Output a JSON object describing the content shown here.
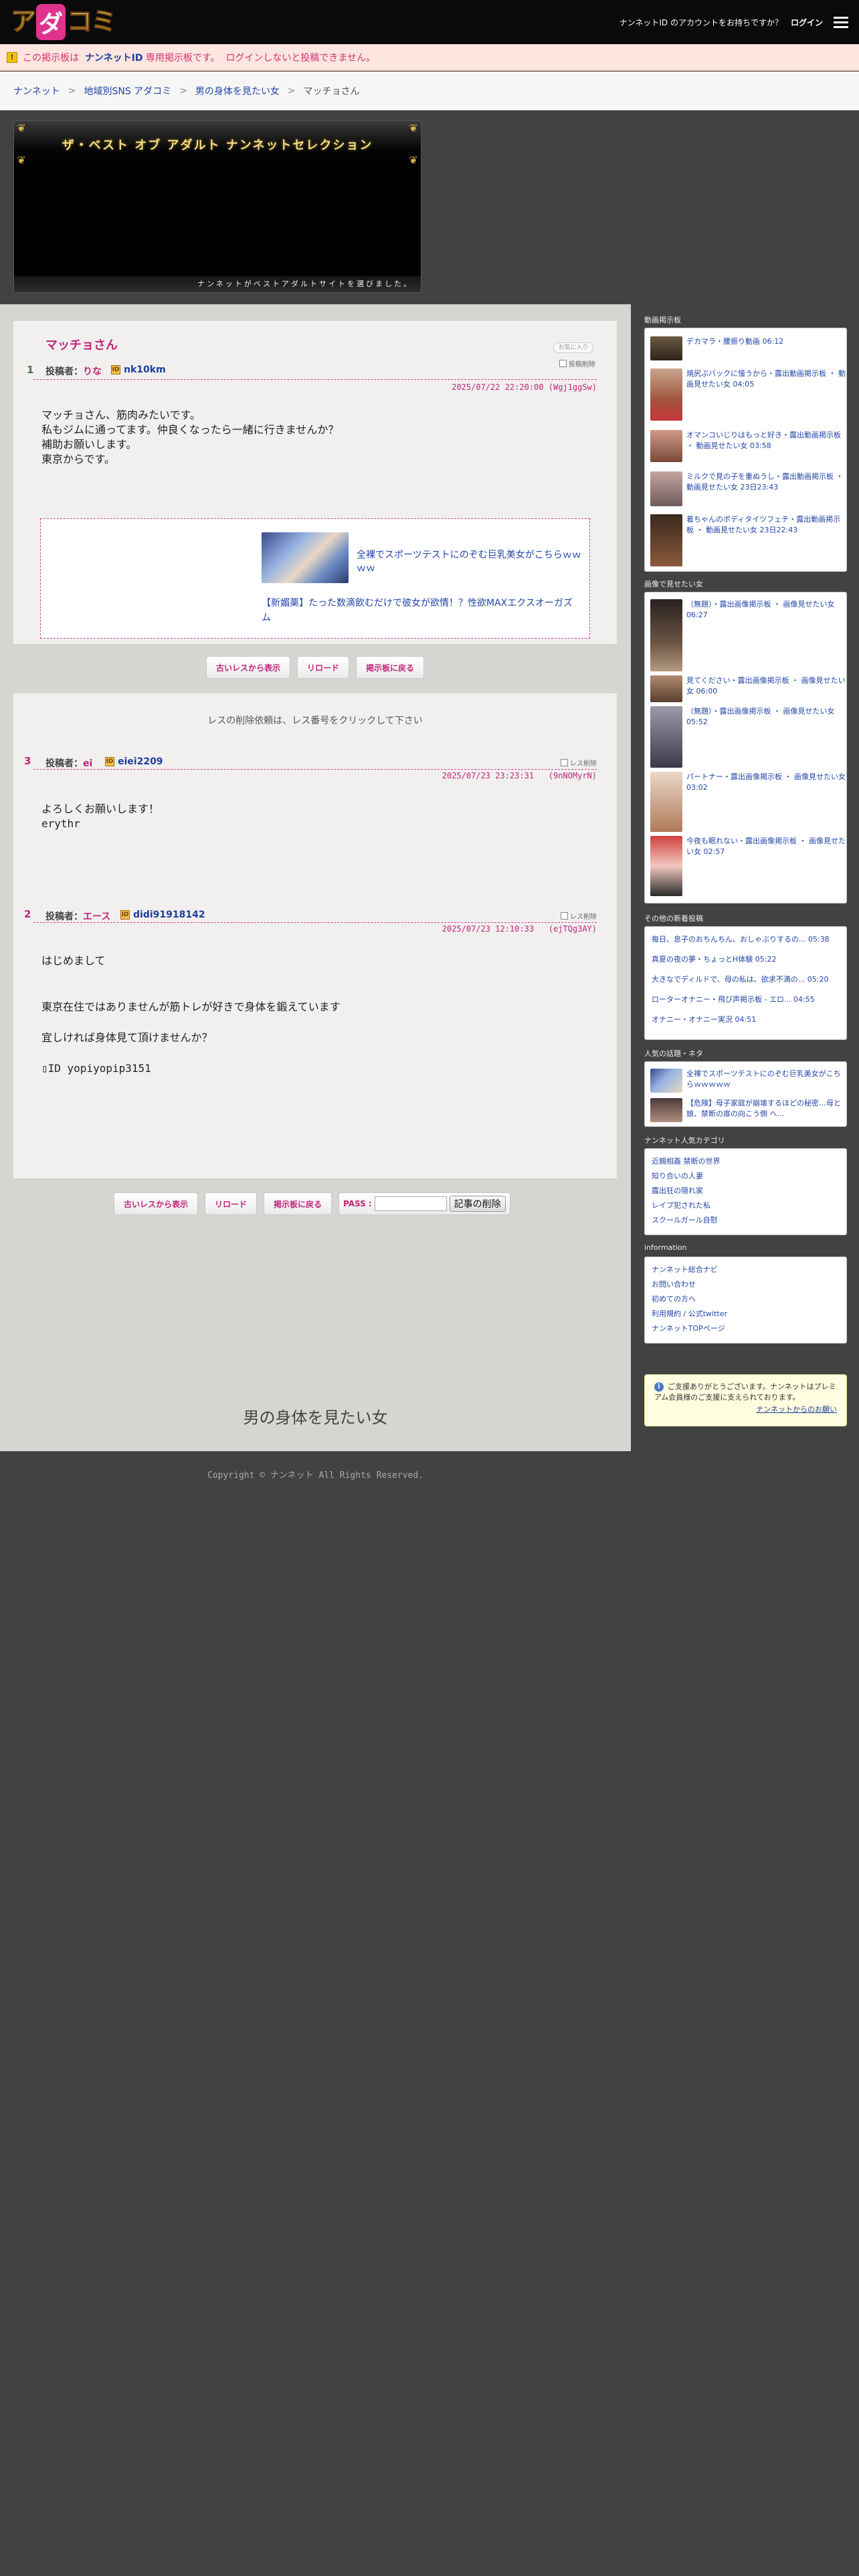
{
  "header": {
    "logo_text": "アダコミ",
    "account_question": "ナンネットID のアカウントをお持ちですか？",
    "login_label": "ログイン"
  },
  "notice": {
    "icon": "!",
    "part1": "この掲示板は",
    "highlight": "ナンネットID",
    "part2": "専用掲示板です。",
    "login": "ログイン",
    "part3": "しないと投稿できません。"
  },
  "breadcrumb": [
    "ナンネット",
    "地域別SNS アダコミ",
    "男の身体を見たい女",
    "マッチョさん"
  ],
  "banner": {
    "title": "ザ・ベスト オブ アダルト ナンネットセレクション",
    "subtitle": "ナンネットがベストアダルトサイトを選びました。"
  },
  "thread": {
    "title": "マッチョさん",
    "post_number": "1",
    "author_label": "投稿者：",
    "author": "りな",
    "badge": "ID",
    "user_id": "nk10km",
    "report_label": "お気に入り",
    "delete_check": "投稿削除",
    "datetime": "2025/07/22 22:20:00",
    "hash": "(Wgj1ggSw)",
    "body": "マッチョさん、筋肉みたいです。\n私もジムに通ってます。仲良くなったら一緒に行きませんか？\n補助お願いします。\n東京からです。",
    "ad_text1": "全裸でスポーツテストにのぞむ巨乳美女がこちらｗｗｗｗ",
    "ad_text2": "【新媚薬】たった数滴飲むだけで彼女が欲情！？性欲MAXエクスオーガズム"
  },
  "buttons": {
    "older": "古いレスから表示",
    "reload": "リロード",
    "back": "掲示板に戻る",
    "pass": "PASS",
    "delete_post": "記事の削除"
  },
  "responses": {
    "delete_note": "レスの削除依頼は、レス番号をクリックして下さい",
    "items": [
      {
        "number": "3",
        "author_label": "投稿者：",
        "author": "ei",
        "badge": "ID",
        "user_id": "eiei2209",
        "delete_check": "レス削除",
        "datetime": "2025/07/23 23:23:31",
        "hash": "(9nNOMyrN)",
        "body": "よろしくお願いします！\nerythr"
      },
      {
        "number": "2",
        "author_label": "投稿者：",
        "author": "エース",
        "badge": "ID",
        "user_id": "didi91918142",
        "delete_check": "レス削除",
        "datetime": "2025/07/23 12:10:33",
        "hash": "(ejTQg3AY)",
        "body": "はじめまして\n\n\n東京在住ではありませんが筋トレが好きで身体を鍛えています\n\n宜しければ身体見て頂けませんか？\n\n▯ID yopiyopip3151"
      }
    ]
  },
  "footer_title": "男の身体を見たい女",
  "copyright": "Copyright © ナンネット All Rights Reserved.",
  "sidebar": {
    "video_board": {
      "heading": "動画掲示板",
      "items": [
        "デカマラ・腰振り動画 06:12",
        "焼尻ぷバックに憧うから・露出動画掲示板 ・ 動画見せたい女 04:05",
        "オマンコいじりはもっと好き・露出動画掲示板 ・ 動画見せたい女 03:58",
        "ミルクで見の子を重ぬうし・露出動画掲示板 ・ 動画見せたい女 23日23:43",
        "着ちゃんのボディタイツフェチ・露出動画掲示板 ・ 動画見せたい女 23日22:43"
      ]
    },
    "image_board": {
      "heading": "画像で見せたい女",
      "items": [
        "（無題）・露出画像掲示板 ・ 画像見せたい女 06:27",
        "見てください・露出画像掲示板 ・ 画像見せたい女 06:00",
        "（無題）・露出画像掲示板 ・ 画像見せたい女 05:52",
        "パートナー・露出画像掲示板 ・ 画像見せたい女 03:02",
        "今夜も眠れない・露出画像掲示板 ・ 画像見せたい女 02:57"
      ]
    },
    "new_posts": {
      "heading": "その他の新着投稿",
      "items": [
        "毎日、息子のおちんちん、おしゃぶりするの... 05:38",
        "真夏の夜の夢・ちょっとH体験 05:22",
        "大きなでディルドで、母の私は、欲求不満の... 05:20",
        "ローターオナニー・飛び声掲示板 - エロ... 04:55",
        "オナニー・オナニー実況 04:51"
      ]
    },
    "popular": {
      "heading": "人気の話題・ネタ",
      "items": [
        "全裸でスポーツテストにのぞむ巨乳美女がこちらｗｗｗｗｗ",
        "【危険】母子家庭が崩壊するほどの秘密…母と娘、禁断の扉の向こう側 へ…"
      ]
    },
    "categories": {
      "heading": "ナンネット人気カテゴリ",
      "items": [
        "近親相姦 禁断の世界",
        "知り合いの人妻",
        "露出狂の隠れ家",
        "レイプ犯された私",
        "スクールガール自慰"
      ]
    },
    "information": {
      "heading": "information",
      "items": [
        "ナンネット総合ナビ",
        "お問い合わせ",
        "初めての方へ",
        "利用規約 / 公式twitter",
        "ナンネットTOPページ"
      ]
    },
    "support": {
      "text": "ご支援ありがとうございます。ナンネットはプレミアム会員様のご支援に支えられております。",
      "link": "ナンネットからのお願い"
    }
  }
}
